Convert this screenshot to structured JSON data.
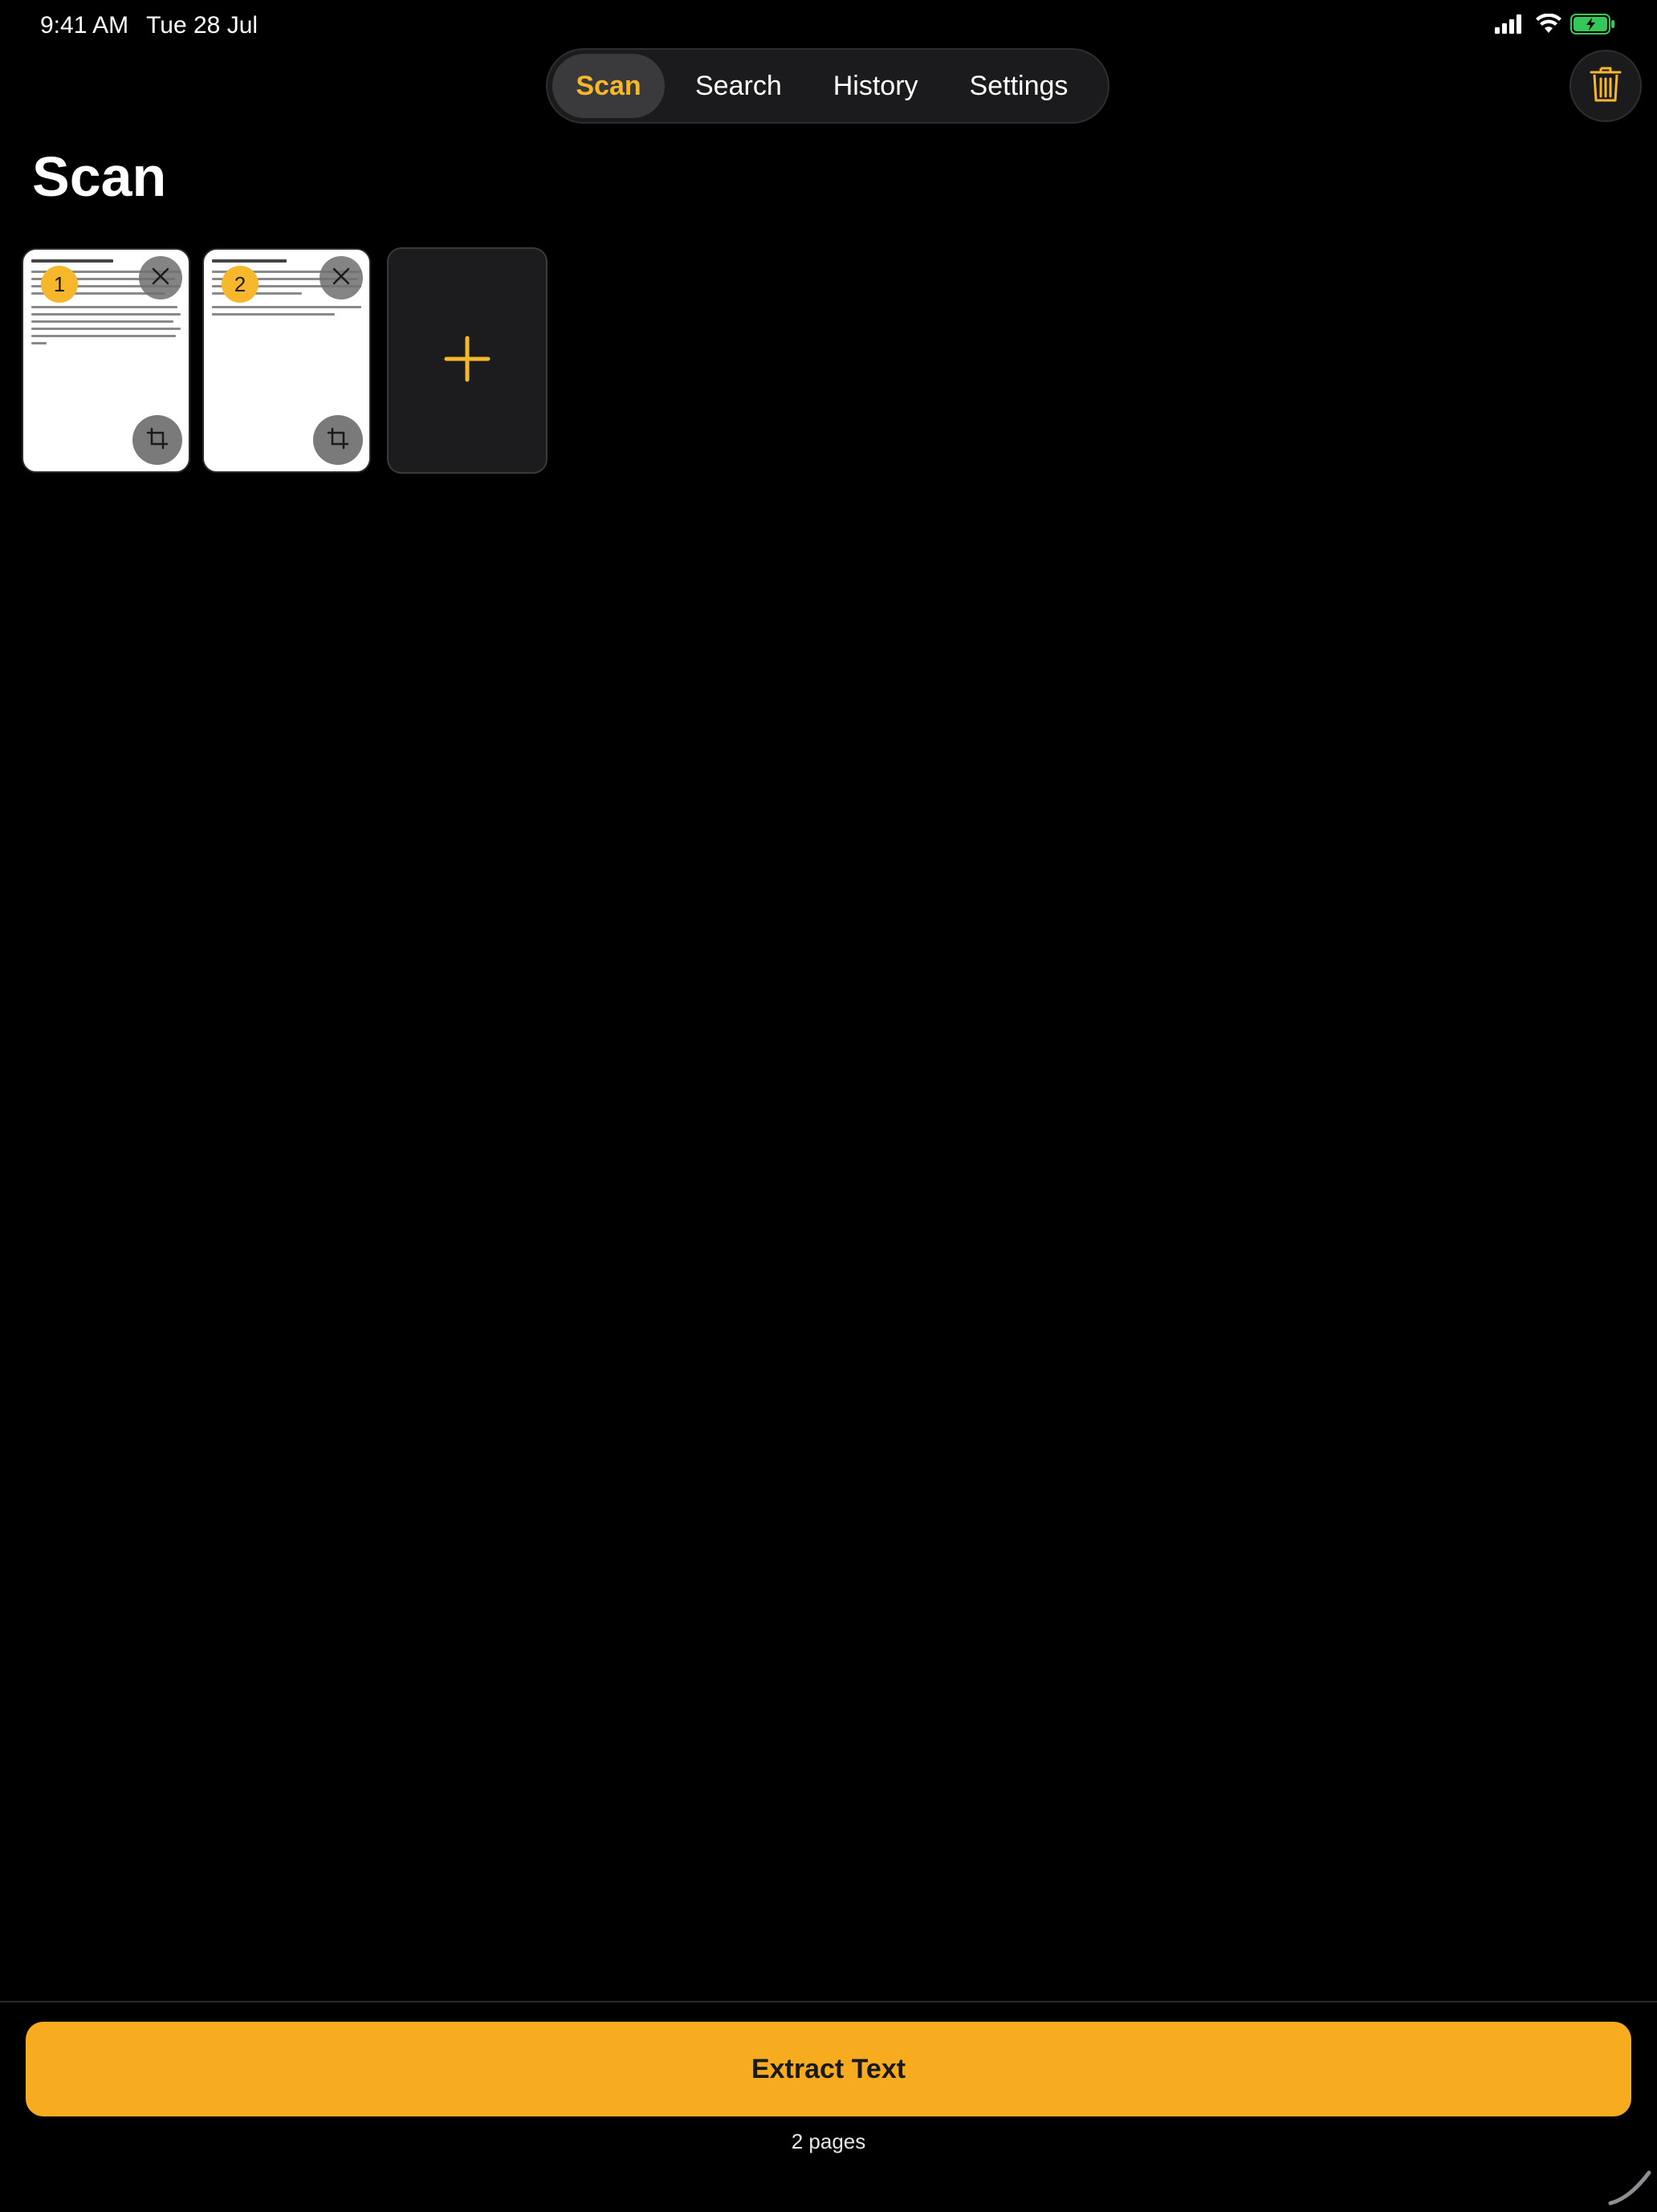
{
  "status_bar": {
    "time": "9:41 AM",
    "date": "Tue 28 Jul",
    "icons": [
      "cellular-signal-icon",
      "wifi-icon",
      "battery-charging-icon"
    ],
    "battery_color": "#34c759"
  },
  "tabs": [
    {
      "label": "Scan",
      "active": true
    },
    {
      "label": "Search",
      "active": false
    },
    {
      "label": "History",
      "active": false
    },
    {
      "label": "Settings",
      "active": false
    }
  ],
  "header": {
    "title": "Scan",
    "trash_icon": "trash-icon"
  },
  "pages": [
    {
      "number": "1",
      "icons": [
        "close-icon",
        "crop-icon"
      ]
    },
    {
      "number": "2",
      "icons": [
        "close-icon",
        "crop-icon"
      ]
    }
  ],
  "add_page_icon": "plus-icon",
  "footer": {
    "extract_label": "Extract Text",
    "pages_count": "2 pages"
  },
  "colors": {
    "accent": "#f7b72b",
    "button": "#f7ab1e",
    "background": "#000000"
  }
}
